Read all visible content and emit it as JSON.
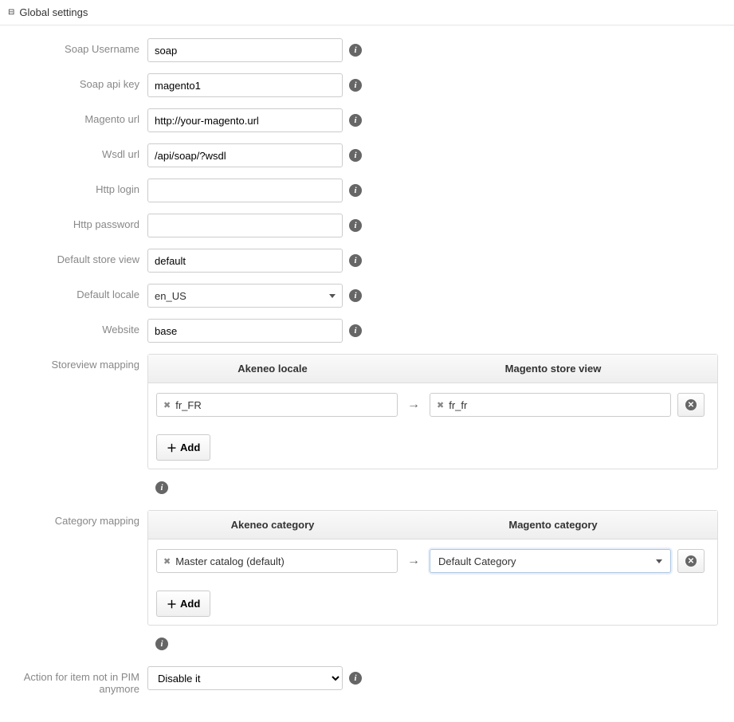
{
  "header": {
    "title": "Global settings"
  },
  "fields": {
    "soap_username": {
      "label": "Soap Username",
      "value": "soap"
    },
    "soap_api_key": {
      "label": "Soap api key",
      "value": "magento1"
    },
    "magento_url": {
      "label": "Magento url",
      "value": "http://your-magento.url"
    },
    "wsdl_url": {
      "label": "Wsdl url",
      "value": "/api/soap/?wsdl"
    },
    "http_login": {
      "label": "Http login",
      "value": ""
    },
    "http_password": {
      "label": "Http password",
      "value": ""
    },
    "default_store_view": {
      "label": "Default store view",
      "value": "default"
    },
    "default_locale": {
      "label": "Default locale",
      "value": "en_US"
    },
    "website": {
      "label": "Website",
      "value": "base"
    }
  },
  "storeview_mapping": {
    "label": "Storeview mapping",
    "col1": "Akeneo locale",
    "col2": "Magento store view",
    "row": {
      "akeneo": "fr_FR",
      "magento": "fr_fr"
    },
    "add_label": "Add"
  },
  "category_mapping": {
    "label": "Category mapping",
    "col1": "Akeneo category",
    "col2": "Magento category",
    "row": {
      "akeneo": "Master catalog (default)",
      "magento": "Default Category"
    },
    "add_label": "Add"
  },
  "action_not_in_pim": {
    "label": "Action for item not in PIM anymore",
    "value": "Disable it"
  }
}
